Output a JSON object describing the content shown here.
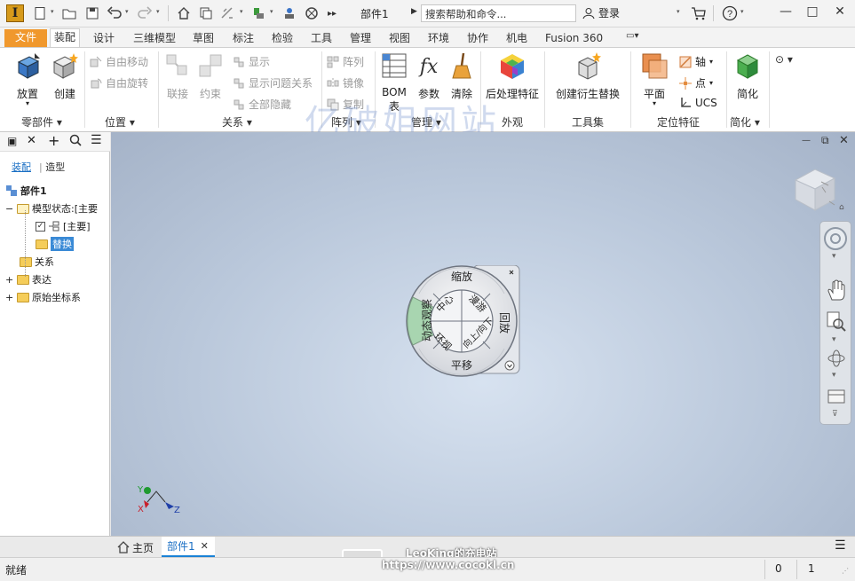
{
  "titlebar": {
    "app_logo": "I",
    "doc_title": "部件1",
    "search_placeholder": "搜索帮助和命令...",
    "login": "登录"
  },
  "tabs": {
    "file": "文件",
    "items": [
      "装配",
      "设计",
      "三维模型",
      "草图",
      "标注",
      "检验",
      "工具",
      "管理",
      "视图",
      "环境",
      "协作",
      "机电",
      "Fusion 360"
    ],
    "active_index": 0
  },
  "ribbon": {
    "place": "放置",
    "create": "创建",
    "free_move": "自由移动",
    "free_rotate": "自由旋转",
    "join": "联接",
    "constrain": "约束",
    "show": "显示",
    "show_problem": "显示问题关系",
    "hide_all": "全部隐藏",
    "pattern": "阵列",
    "mirror": "镜像",
    "copy": "复制",
    "bom": "BOM",
    "bom2": "表",
    "params": "参数",
    "purge": "清除",
    "postprocess": "后处理特征",
    "create_sub": "创建衍生替换",
    "plane": "平面",
    "axis": "轴",
    "point": "点",
    "ucs": "UCS",
    "simplify": "简化",
    "panels": {
      "component": "零部件",
      "position": "位置",
      "relation": "关系",
      "pattern": "阵列",
      "manage": "管理",
      "appearance": "外观",
      "toolset": "工具集",
      "workfeatures": "定位特征",
      "simplify": "简化"
    },
    "watermark": "亿破姐网站"
  },
  "browser": {
    "tab_assembly": "装配",
    "tab_modeling": "造型",
    "root": "部件1",
    "model_state": "模型状态:[主要",
    "primary": "[主要]",
    "substitute": "替换",
    "relations": "关系",
    "representations": "表达",
    "origin": "原始坐标系"
  },
  "wheel": {
    "zoom": "缩放",
    "orbit": "动态观察",
    "center": "中心",
    "walk": "漫游",
    "rewind": "回放",
    "updown": "向上/向下",
    "look": "环视",
    "pan": "平移"
  },
  "triad": {
    "x": "X",
    "y": "Y",
    "z": "Z"
  },
  "doctabs": {
    "home": "主页",
    "doc": "部件1"
  },
  "watermark_bottom": {
    "line1": "LeoKing的充电站",
    "line2": "https://www.cocokl.cn"
  },
  "status": {
    "text": "就绪",
    "count1": "0",
    "count2": "1"
  }
}
